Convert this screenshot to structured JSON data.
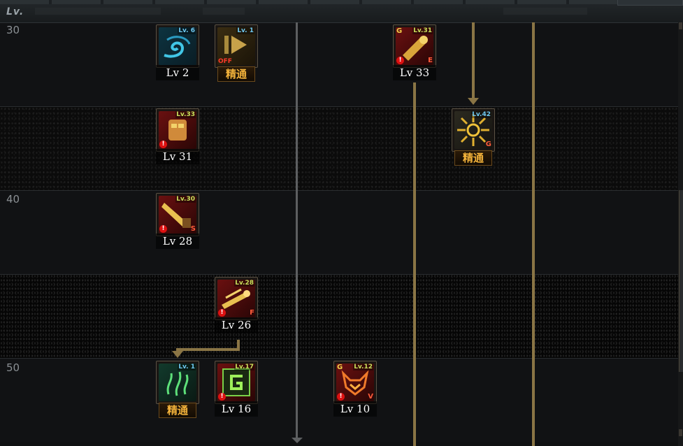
{
  "header": {
    "lv_tag": "Lv."
  },
  "level_labels": [
    "30",
    "40",
    "50"
  ],
  "skills": [
    {
      "id": "wind",
      "icon": "wind-swirl-icon",
      "color": "blue",
      "req": "Lv. 6",
      "req_color": "blue",
      "grade": "",
      "tag": "",
      "warn": false,
      "off": false,
      "level_text": "Lv 2",
      "mastery": false
    },
    {
      "id": "toggle",
      "icon": "play-toggle-icon",
      "color": "gold",
      "req": "Lv. 1",
      "req_color": "blue",
      "grade": "",
      "tag": "",
      "warn": false,
      "off": true,
      "off_text": "OFF",
      "level_text": "精通",
      "mastery": true
    },
    {
      "id": "cannon",
      "icon": "cannon-icon",
      "color": "red",
      "req": "Lv.31",
      "req_color": "green",
      "grade": "G",
      "tag": "E",
      "warn": true,
      "off": false,
      "level_text": "Lv 33",
      "mastery": false
    },
    {
      "id": "golem",
      "icon": "golem-icon",
      "color": "red",
      "req": "Lv.33",
      "req_color": "green",
      "grade": "",
      "tag": "",
      "warn": true,
      "off": false,
      "level_text": "Lv 31",
      "mastery": false
    },
    {
      "id": "burst",
      "icon": "burst-icon",
      "color": "dark",
      "req": "Lv.42",
      "req_color": "blue",
      "grade": "",
      "tag": "G",
      "warn": false,
      "off": false,
      "level_text": "精通",
      "mastery": true
    },
    {
      "id": "hammer",
      "icon": "hammer-icon",
      "color": "red",
      "req": "Lv.30",
      "req_color": "green",
      "grade": "",
      "tag": "S",
      "warn": true,
      "off": false,
      "level_text": "Lv 28",
      "mastery": false
    },
    {
      "id": "barrage",
      "icon": "barrage-icon",
      "color": "red",
      "req": "Lv.28",
      "req_color": "green",
      "grade": "",
      "tag": "F",
      "warn": true,
      "off": false,
      "level_text": "Lv 26",
      "mastery": false
    },
    {
      "id": "poison",
      "icon": "spirit-icon",
      "color": "green",
      "req": "Lv. 1",
      "req_color": "blue",
      "grade": "",
      "tag": "",
      "warn": false,
      "off": false,
      "level_text": "精通",
      "mastery": true
    },
    {
      "id": "gear",
      "icon": "gear-g-icon",
      "color": "red",
      "req": "Lv.17",
      "req_color": "green",
      "grade": "",
      "tag": "",
      "warn": true,
      "off": false,
      "level_text": "Lv 16",
      "mastery": false
    },
    {
      "id": "demon",
      "icon": "demon-icon",
      "color": "red",
      "req": "Lv.12",
      "req_color": "green",
      "grade": "G",
      "tag": "V",
      "warn": true,
      "off": false,
      "level_text": "Lv 10",
      "mastery": false
    }
  ]
}
